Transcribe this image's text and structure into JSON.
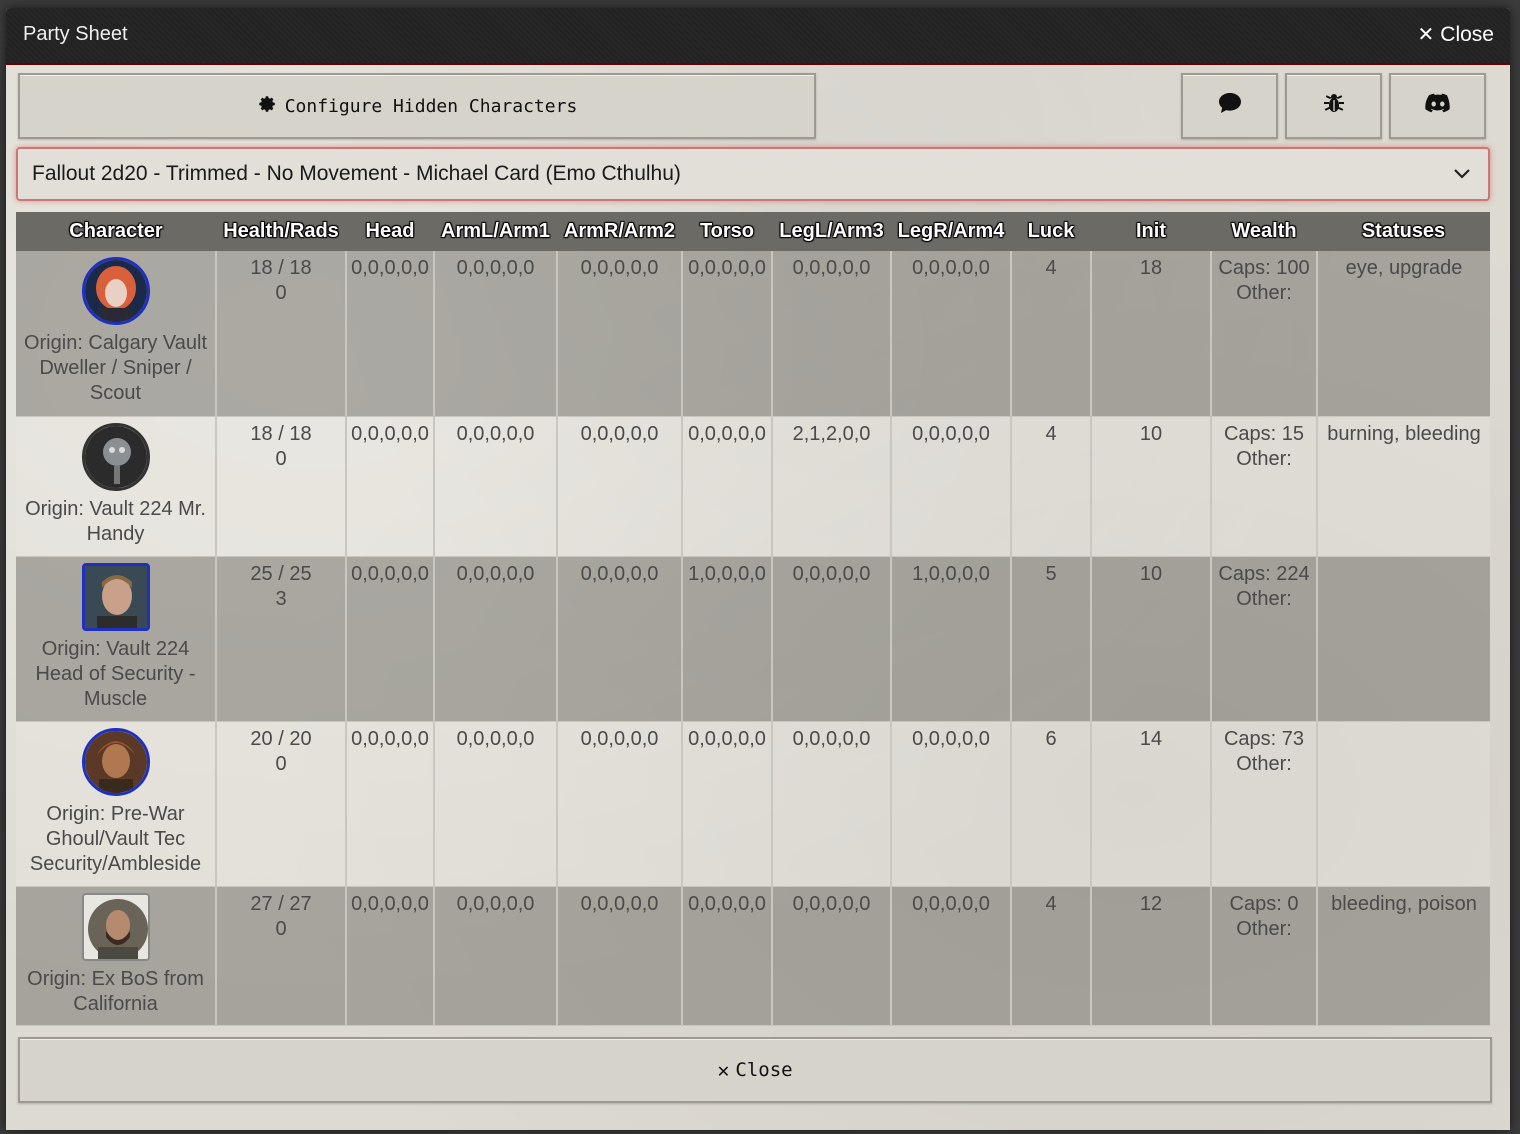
{
  "window": {
    "title": "Party Sheet",
    "close_label": "Close"
  },
  "toolbar": {
    "configure_label": "Configure Hidden Characters",
    "icons": [
      "gear-icon",
      "chat-bubble-icon",
      "bug-icon",
      "discord-icon"
    ]
  },
  "campaign_select": {
    "value": "Fallout 2d20 - Trimmed - No Movement - Michael Card (Emo Cthulhu)"
  },
  "table": {
    "headers": [
      "Character",
      "Health/Rads",
      "Head",
      "ArmL/Arm1",
      "ArmR/Arm2",
      "Torso",
      "LegL/Arm3",
      "LegR/Arm4",
      "Luck",
      "Init",
      "Wealth",
      "Statuses"
    ],
    "rows": [
      {
        "origin": "Origin: Calgary Vault Dweller / Sniper / Scout",
        "health": "18 / 18",
        "rads": "0",
        "head": "0,0,0,0,0",
        "arml": "0,0,0,0,0",
        "armr": "0,0,0,0,0",
        "torso": "0,0,0,0,0",
        "legl": "0,0,0,0,0",
        "legr": "0,0,0,0,0",
        "luck": "4",
        "init": "18",
        "caps": "Caps: 100",
        "other": "Other:",
        "statuses": "eye, upgrade"
      },
      {
        "origin": "Origin: Vault 224 Mr. Handy",
        "health": "18 / 18",
        "rads": "0",
        "head": "0,0,0,0,0",
        "arml": "0,0,0,0,0",
        "armr": "0,0,0,0,0",
        "torso": "0,0,0,0,0",
        "legl": "2,1,2,0,0",
        "legr": "0,0,0,0,0",
        "luck": "4",
        "init": "10",
        "caps": "Caps: 15",
        "other": "Other:",
        "statuses": "burning, bleeding"
      },
      {
        "origin": "Origin: Vault 224 Head of Security - Muscle",
        "health": "25 / 25",
        "rads": "3",
        "head": "0,0,0,0,0",
        "arml": "0,0,0,0,0",
        "armr": "0,0,0,0,0",
        "torso": "1,0,0,0,0",
        "legl": "0,0,0,0,0",
        "legr": "1,0,0,0,0",
        "luck": "5",
        "init": "10",
        "caps": "Caps: 224",
        "other": "Other:",
        "statuses": ""
      },
      {
        "origin": "Origin: Pre-War Ghoul/Vault Tec Security/Ambleside",
        "health": "20 / 20",
        "rads": "0",
        "head": "0,0,0,0,0",
        "arml": "0,0,0,0,0",
        "armr": "0,0,0,0,0",
        "torso": "0,0,0,0,0",
        "legl": "0,0,0,0,0",
        "legr": "0,0,0,0,0",
        "luck": "6",
        "init": "14",
        "caps": "Caps: 73",
        "other": "Other:",
        "statuses": ""
      },
      {
        "origin": "Origin: Ex BoS from California",
        "health": "27 / 27",
        "rads": "0",
        "head": "0,0,0,0,0",
        "arml": "0,0,0,0,0",
        "armr": "0,0,0,0,0",
        "torso": "0,0,0,0,0",
        "legl": "0,0,0,0,0",
        "legr": "0,0,0,0,0",
        "luck": "4",
        "init": "12",
        "caps": "Caps: 0",
        "other": "Other:",
        "statuses": "bleeding, poison"
      }
    ]
  },
  "footer": {
    "close_label": "Close"
  }
}
